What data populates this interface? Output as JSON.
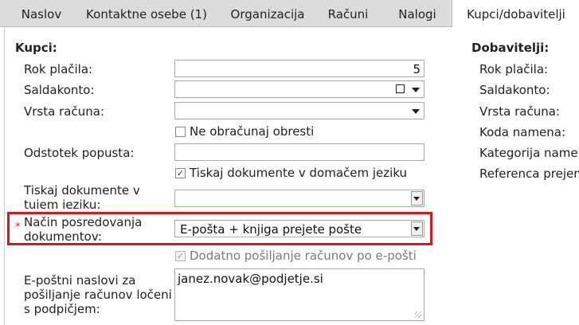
{
  "tabs": [
    {
      "label": "Naslov"
    },
    {
      "label": "Kontaktne osebe (1)"
    },
    {
      "label": "Organizacija"
    },
    {
      "label": "Računi"
    },
    {
      "label": "Nalogi"
    },
    {
      "label": "Kupci/dobavitelji",
      "active": true
    }
  ],
  "kupci": {
    "heading": "Kupci:",
    "rok_placila": {
      "label": "Rok plačila:",
      "value": "5"
    },
    "saldakonto": {
      "label": "Saldakonto:",
      "value": ""
    },
    "vrsta_racuna": {
      "label": "Vrsta računa:",
      "value": ""
    },
    "ne_obracunaj": {
      "label": "Ne obračunaj obresti",
      "checked": false
    },
    "odstotek_popusta": {
      "label": "Odstotek popusta:",
      "value": ""
    },
    "tiskaj_domace": {
      "label": "Tiskaj dokumente v domačem jeziku",
      "checked": true
    },
    "tiskaj_tuj": {
      "label": "Tiskaj dokumente v tujem jeziku:",
      "value": ""
    },
    "nacin": {
      "label": "Način posredovanja dokumentov:",
      "required_mark": "*",
      "value": "E-pošta + knjiga prejete pošte"
    },
    "dodatno": {
      "label": "Dodatno pošiljanje računov po e-pošti",
      "checked": true,
      "disabled": true
    },
    "eposta": {
      "label": "E-poštni naslovi za pošiljanje računov ločeni s podpičjem:",
      "value": "janez.novak@podjetje.si"
    }
  },
  "dobavitelji": {
    "heading": "Dobavitelji:",
    "labels": [
      "Rok plačila:",
      "Saldakonto:",
      "Vrsta računa:",
      "Koda namena:",
      "Kategorija namena",
      "Referenca prejem"
    ]
  },
  "icons": {
    "checkmark": "✓",
    "calendar": "calendar-icon",
    "dropdown": "chevron-down-icon"
  },
  "colors": {
    "highlight": "#e0141b",
    "required": "#d9232a"
  }
}
